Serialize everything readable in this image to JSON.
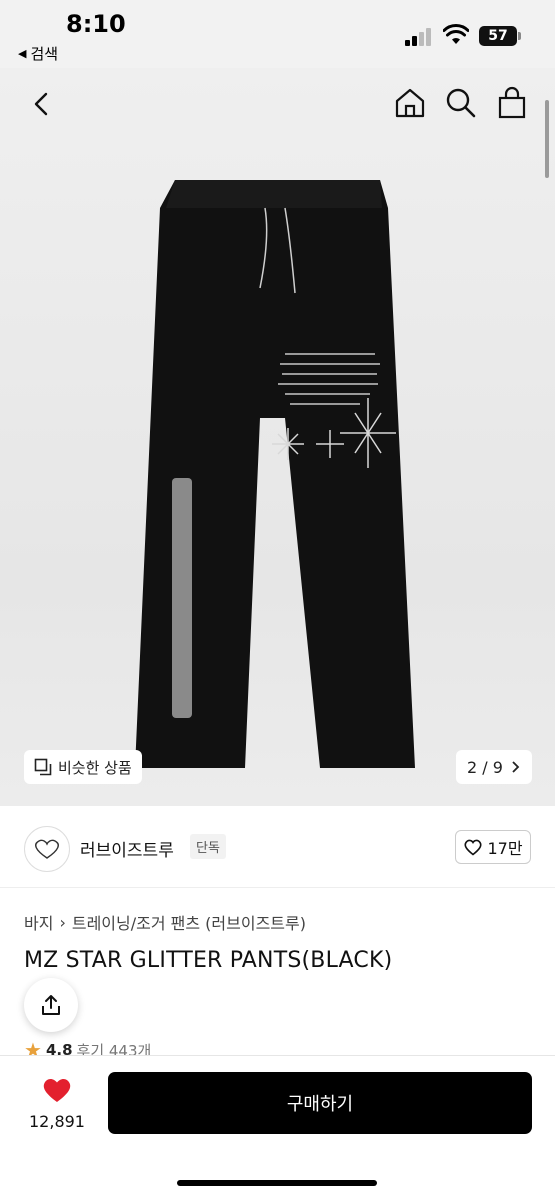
{
  "status_bar": {
    "time": "8:10",
    "back_app": "검색",
    "battery": "57"
  },
  "nav": {
    "back_icon": "chevron-left-icon",
    "home_icon": "home-icon",
    "search_icon": "search-icon",
    "bag_icon": "shopping-bag-icon"
  },
  "gallery": {
    "similar_button": "비슷한 상품",
    "page_current": "2",
    "page_total": "9",
    "page_text": "2 / 9"
  },
  "brand": {
    "name": "러브이즈트루",
    "badge": "단독",
    "likes": "17만"
  },
  "breadcrumb": {
    "category": "바지",
    "subcategory": "트레이닝/조거 팬츠 (러브이즈트루)"
  },
  "product": {
    "title": "MZ STAR GLITTER PANTS(BLACK)",
    "rating": "4.8",
    "reviews": "후기 443개"
  },
  "bottom_bar": {
    "wish_count": "12,891",
    "buy_label": "구매하기"
  },
  "colors": {
    "heart": "#e3202e",
    "star": "#e8a13c",
    "buy_button": "#000000"
  }
}
